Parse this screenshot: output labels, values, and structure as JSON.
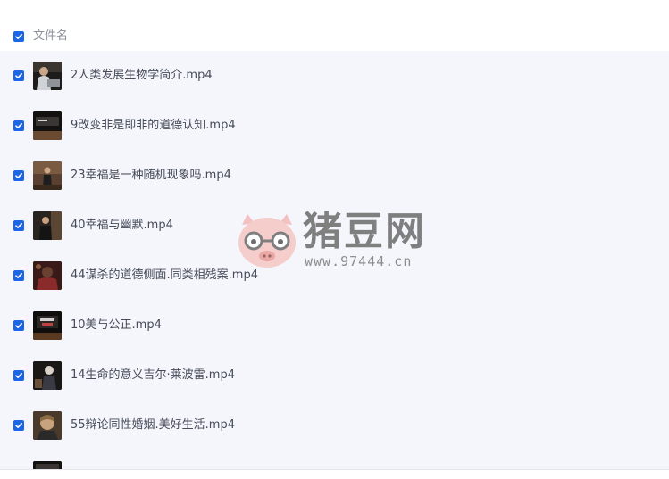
{
  "header": {
    "select_all_checked": true,
    "column_label": "文件名"
  },
  "files": [
    {
      "name": "2人类发展生物学简介.mp4",
      "checked": true,
      "thumb_icon": "video-thumbnail"
    },
    {
      "name": "9改变非是即非的道德认知.mp4",
      "checked": true,
      "thumb_icon": "video-thumbnail"
    },
    {
      "name": "23幸福是一种随机现象吗.mp4",
      "checked": true,
      "thumb_icon": "video-thumbnail"
    },
    {
      "name": "40幸福与幽默.mp4",
      "checked": true,
      "thumb_icon": "video-thumbnail"
    },
    {
      "name": "44谋杀的道德侧面.同类相残案.mp4",
      "checked": true,
      "thumb_icon": "video-thumbnail"
    },
    {
      "name": "10美与公正.mp4",
      "checked": true,
      "thumb_icon": "video-thumbnail"
    },
    {
      "name": "14生命的意义吉尔·莱波雷.mp4",
      "checked": true,
      "thumb_icon": "video-thumbnail"
    },
    {
      "name": "55辩论同性婚姻.美好生活.mp4",
      "checked": true,
      "thumb_icon": "video-thumbnail"
    },
    {
      "name": "",
      "checked": false,
      "thumb_icon": "video-thumbnail"
    }
  ],
  "watermark": {
    "brand": "猪豆网",
    "url": "www.97444.cn",
    "logo_icon": "pig-with-glasses-logo"
  },
  "colors": {
    "accent": "#1a66e6",
    "list_background": "#f5f6fc",
    "text": "#454b57",
    "header_text": "#8a8f99"
  }
}
